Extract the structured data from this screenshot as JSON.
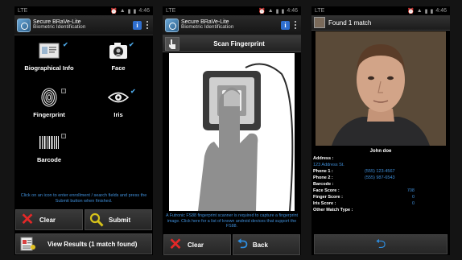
{
  "status": {
    "time": "4:46",
    "left_label": "LTE"
  },
  "app": {
    "title": "Secure BRaVe-Lite",
    "subtitle": "Biometric Identification",
    "info": "i"
  },
  "screen1": {
    "items": [
      {
        "label": "Biographical Info",
        "icon": "id-card-icon",
        "checked": true
      },
      {
        "label": "Face",
        "icon": "camera-icon",
        "checked": true
      },
      {
        "label": "Fingerprint",
        "icon": "fingerprint-icon",
        "checked": false
      },
      {
        "label": "Iris",
        "icon": "eye-icon",
        "checked": true
      },
      {
        "label": "Barcode",
        "icon": "barcode-icon",
        "checked": false
      }
    ],
    "hint": "Click on an icon to enter enrollment / search fields and press the Submit button when finished.",
    "clear_label": "Clear",
    "submit_label": "Submit",
    "view_results_label": "View Results (1 match found)"
  },
  "screen2": {
    "title": "Scan Fingerprint",
    "message": "A Futronic FS88 fingerprint scanner is required to capture a fingerprint image. Click here for a list of known android devices that support the FS88.",
    "clear_label": "Clear",
    "back_label": "Back"
  },
  "screen3": {
    "title": "Found 1 match",
    "name": "John doe",
    "address_label": "Address :",
    "address_value": "123 Address St.",
    "phone1_label": "Phone 1 :",
    "phone1_value": "(555) 123-4567",
    "phone2_label": "Phone 2 :",
    "phone2_value": "(555) 987-6543",
    "barcode_label": "Barcode :",
    "face_label": "Face Score :",
    "face_value": "708",
    "finger_label": "Finger Score :",
    "finger_value": "0",
    "iris_label": "Iris Score :",
    "iris_value": "0",
    "other_label": "Other Match Type :"
  },
  "colors": {
    "accent_blue": "#3f8ed8",
    "clear_red": "#e32828",
    "check_blue": "#4aa3e0"
  }
}
